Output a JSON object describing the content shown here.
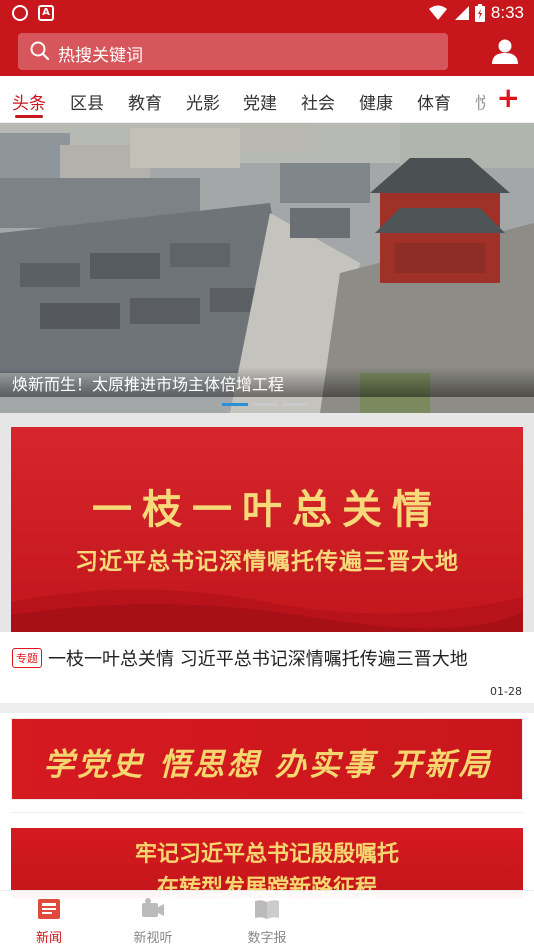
{
  "status_bar": {
    "time": "8:33"
  },
  "search": {
    "placeholder": "热搜关键词"
  },
  "tabs": [
    {
      "label": "头条",
      "active": true
    },
    {
      "label": "区县"
    },
    {
      "label": "教育"
    },
    {
      "label": "光影"
    },
    {
      "label": "党建"
    },
    {
      "label": "社会"
    },
    {
      "label": "健康"
    },
    {
      "label": "体育"
    },
    {
      "label": "悦"
    }
  ],
  "tab_add_label": "+",
  "hero": {
    "caption": "焕新而生！太原推进市场主体倍增工程",
    "slide_count": 3,
    "active_slide": 1
  },
  "feature": {
    "banner_title": "一枝一叶总关情",
    "banner_subtitle": "习近平总书记深情嘱托传遍三晋大地",
    "tag": "专题",
    "title": "一枝一叶总关情 习近平总书记深情嘱托传遍三晋大地",
    "date": "01-28"
  },
  "banner2": {
    "text": "学党史 悟思想 办实事 开新局"
  },
  "banner3": {
    "line1": "牢记习近平总书记殷殷嘱托",
    "line2": "在转型发展蹚新路征程"
  },
  "bottom_nav": [
    {
      "label": "新闻",
      "active": true,
      "icon": "news-icon"
    },
    {
      "label": "新视听",
      "icon": "video-icon"
    },
    {
      "label": "数字报",
      "icon": "book-icon"
    }
  ],
  "colors": {
    "brand_red": "#c8161d",
    "gold": "#f7d97a",
    "dot_active": "#2b8fd6"
  }
}
